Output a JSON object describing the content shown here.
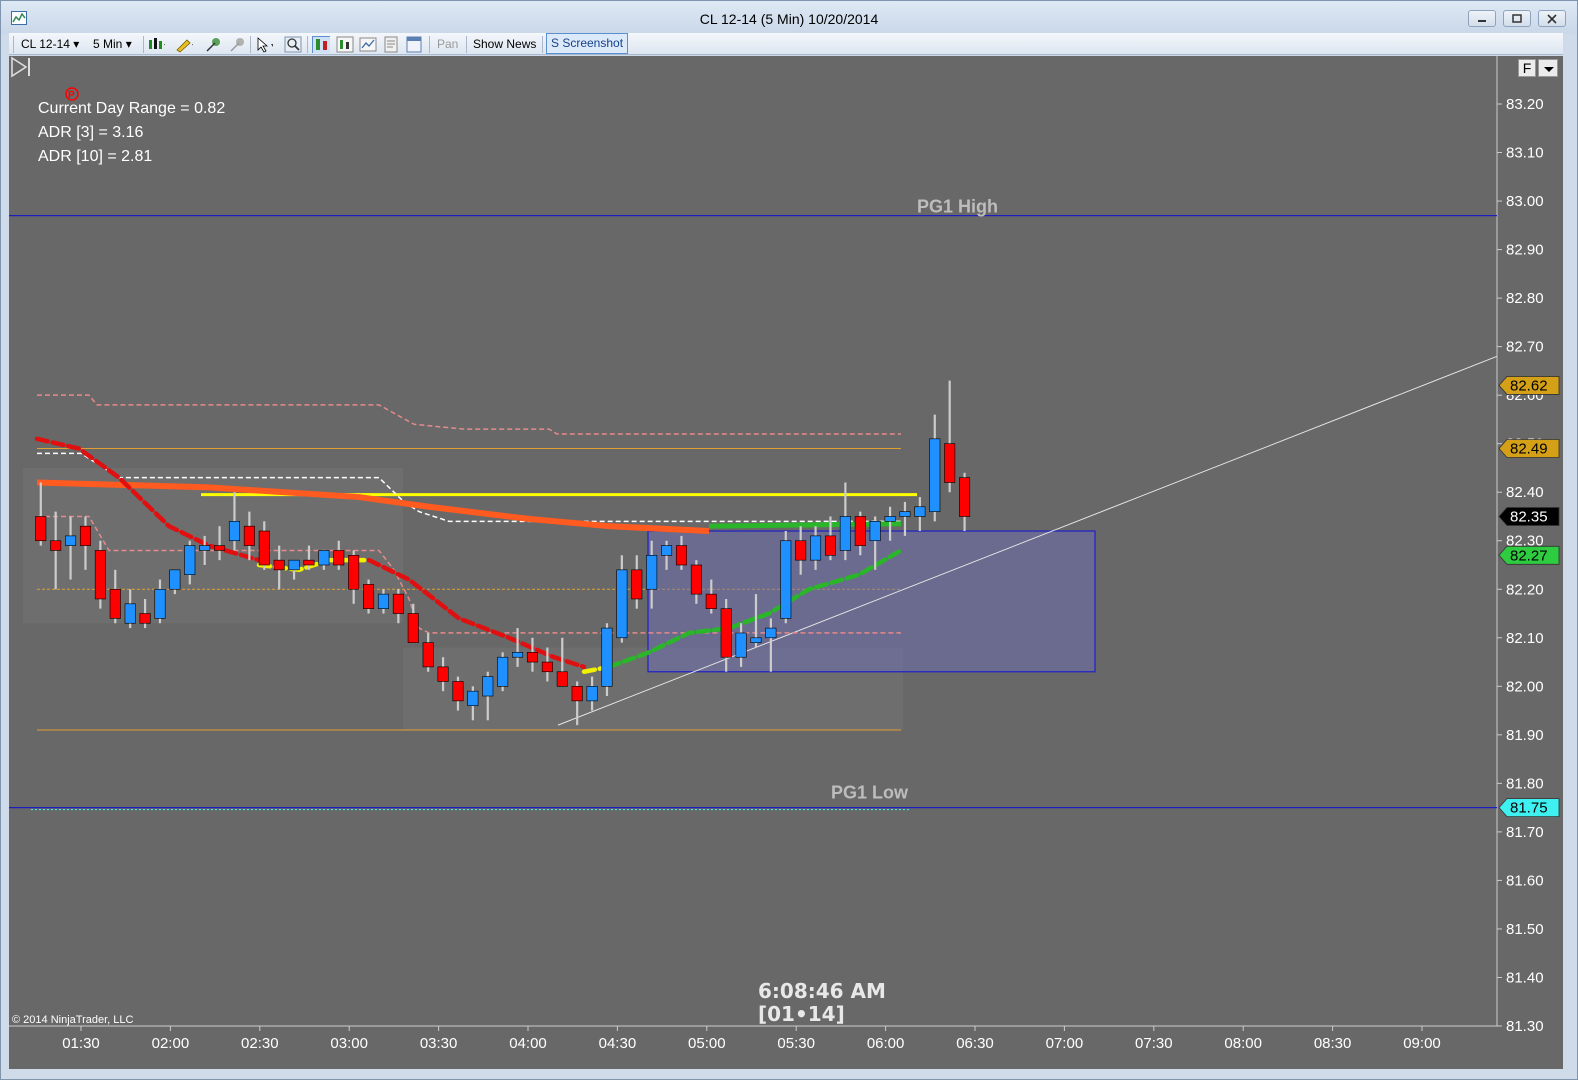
{
  "window": {
    "title": "CL 12-14 (5 Min)  10/20/2014"
  },
  "toolbar": {
    "instrument": "CL 12-14",
    "interval": "5 Min",
    "pan_label": "Pan",
    "news_label": "Show News",
    "screenshot_label": "S Screenshot"
  },
  "info": {
    "range": "Current Day Range = 0.82",
    "adr3": "ADR [3] = 3.16",
    "adr10": "ADR [10] = 2.81"
  },
  "labels": {
    "pg1_high": "PG1 High",
    "pg1_low": "PG1 Low",
    "copyright": "© 2014 NinjaTrader, LLC",
    "clock": "6:08:46 AM",
    "counter": "[01•14]",
    "f_button": "F"
  },
  "chart_data": {
    "type": "candlestick",
    "x_ticks": [
      "01:30",
      "02:00",
      "02:30",
      "03:00",
      "03:30",
      "04:00",
      "04:30",
      "05:00",
      "05:30",
      "06:00",
      "06:30",
      "07:00",
      "07:30",
      "08:00",
      "08:30",
      "09:00"
    ],
    "y_ticks": [
      "83.20",
      "83.10",
      "83.00",
      "82.90",
      "82.80",
      "82.70",
      "82.60",
      "82.50",
      "82.40",
      "82.30",
      "82.20",
      "82.10",
      "82.00",
      "81.90",
      "81.80",
      "81.70",
      "81.60",
      "81.50",
      "81.40",
      "81.30"
    ],
    "ylim": [
      81.3,
      83.2
    ],
    "price_markers": [
      {
        "label": "82.62",
        "value": 82.62,
        "color": "#d4a017"
      },
      {
        "label": "82.49",
        "value": 82.49,
        "color": "#d4a017"
      },
      {
        "label": "82.35",
        "value": 82.35,
        "color": "#000000"
      },
      {
        "label": "82.27",
        "value": 82.27,
        "color": "#2ecc40"
      },
      {
        "label": "81.75",
        "value": 81.75,
        "color": "#3ff0f0"
      }
    ],
    "levels": [
      {
        "name": "PG1 High",
        "value": 82.97,
        "color": "#1e1ebf"
      },
      {
        "name": "PG1 Low",
        "value": 81.75,
        "color": "#1e1ebf"
      },
      {
        "value": 82.49,
        "color": "#e0a030"
      },
      {
        "value": 81.91,
        "color": "#e0a030"
      },
      {
        "value": 82.2,
        "color": "#e0a030"
      },
      {
        "value": 82.395,
        "color": "#ffff00"
      }
    ],
    "colors": {
      "up": "#1e90ff",
      "down": "#ff0000",
      "wick": "#cccccc",
      "background": "#686868"
    },
    "candles": [
      {
        "o": 82.35,
        "h": 82.42,
        "l": 82.29,
        "c": 82.3
      },
      {
        "o": 82.3,
        "h": 82.36,
        "l": 82.2,
        "c": 82.28
      },
      {
        "o": 82.29,
        "h": 82.35,
        "l": 82.22,
        "c": 82.31
      },
      {
        "o": 82.33,
        "h": 82.35,
        "l": 82.24,
        "c": 82.29
      },
      {
        "o": 82.28,
        "h": 82.3,
        "l": 82.16,
        "c": 82.18
      },
      {
        "o": 82.2,
        "h": 82.24,
        "l": 82.13,
        "c": 82.14
      },
      {
        "o": 82.13,
        "h": 82.2,
        "l": 82.12,
        "c": 82.17
      },
      {
        "o": 82.15,
        "h": 82.18,
        "l": 82.12,
        "c": 82.13
      },
      {
        "o": 82.14,
        "h": 82.22,
        "l": 82.13,
        "c": 82.2
      },
      {
        "o": 82.2,
        "h": 82.24,
        "l": 82.19,
        "c": 82.24
      },
      {
        "o": 82.23,
        "h": 82.3,
        "l": 82.21,
        "c": 82.29
      },
      {
        "o": 82.28,
        "h": 82.31,
        "l": 82.25,
        "c": 82.29
      },
      {
        "o": 82.29,
        "h": 82.33,
        "l": 82.26,
        "c": 82.28
      },
      {
        "o": 82.3,
        "h": 82.4,
        "l": 82.28,
        "c": 82.34
      },
      {
        "o": 82.33,
        "h": 82.36,
        "l": 82.26,
        "c": 82.29
      },
      {
        "o": 82.32,
        "h": 82.34,
        "l": 82.24,
        "c": 82.25
      },
      {
        "o": 82.26,
        "h": 82.29,
        "l": 82.2,
        "c": 82.24
      },
      {
        "o": 82.24,
        "h": 82.26,
        "l": 82.22,
        "c": 82.26
      },
      {
        "o": 82.26,
        "h": 82.29,
        "l": 82.24,
        "c": 82.25
      },
      {
        "o": 82.25,
        "h": 82.28,
        "l": 82.24,
        "c": 82.28
      },
      {
        "o": 82.28,
        "h": 82.3,
        "l": 82.24,
        "c": 82.25
      },
      {
        "o": 82.27,
        "h": 82.28,
        "l": 82.17,
        "c": 82.2
      },
      {
        "o": 82.21,
        "h": 82.22,
        "l": 82.15,
        "c": 82.16
      },
      {
        "o": 82.16,
        "h": 82.2,
        "l": 82.15,
        "c": 82.19
      },
      {
        "o": 82.19,
        "h": 82.2,
        "l": 82.13,
        "c": 82.15
      },
      {
        "o": 82.15,
        "h": 82.17,
        "l": 82.1,
        "c": 82.09
      },
      {
        "o": 82.09,
        "h": 82.11,
        "l": 82.03,
        "c": 82.04
      },
      {
        "o": 82.04,
        "h": 82.06,
        "l": 81.99,
        "c": 82.01
      },
      {
        "o": 82.01,
        "h": 82.02,
        "l": 81.95,
        "c": 81.97
      },
      {
        "o": 81.96,
        "h": 82.0,
        "l": 81.93,
        "c": 81.99
      },
      {
        "o": 81.98,
        "h": 82.03,
        "l": 81.93,
        "c": 82.02
      },
      {
        "o": 82.0,
        "h": 82.07,
        "l": 81.99,
        "c": 82.06
      },
      {
        "o": 82.06,
        "h": 82.12,
        "l": 82.04,
        "c": 82.07
      },
      {
        "o": 82.07,
        "h": 82.1,
        "l": 82.03,
        "c": 82.05
      },
      {
        "o": 82.05,
        "h": 82.08,
        "l": 82.01,
        "c": 82.03
      },
      {
        "o": 82.03,
        "h": 82.1,
        "l": 82.0,
        "c": 82.0
      },
      {
        "o": 82.0,
        "h": 82.01,
        "l": 81.92,
        "c": 81.97
      },
      {
        "o": 81.97,
        "h": 82.02,
        "l": 81.95,
        "c": 82.0
      },
      {
        "o": 82.0,
        "h": 82.13,
        "l": 81.98,
        "c": 82.12
      },
      {
        "o": 82.1,
        "h": 82.27,
        "l": 82.09,
        "c": 82.24
      },
      {
        "o": 82.24,
        "h": 82.27,
        "l": 82.16,
        "c": 82.18
      },
      {
        "o": 82.2,
        "h": 82.3,
        "l": 82.16,
        "c": 82.27
      },
      {
        "o": 82.27,
        "h": 82.3,
        "l": 82.24,
        "c": 82.29
      },
      {
        "o": 82.29,
        "h": 82.31,
        "l": 82.24,
        "c": 82.25
      },
      {
        "o": 82.25,
        "h": 82.26,
        "l": 82.17,
        "c": 82.19
      },
      {
        "o": 82.19,
        "h": 82.22,
        "l": 82.15,
        "c": 82.16
      },
      {
        "o": 82.16,
        "h": 82.18,
        "l": 82.03,
        "c": 82.06
      },
      {
        "o": 82.06,
        "h": 82.13,
        "l": 82.04,
        "c": 82.11
      },
      {
        "o": 82.09,
        "h": 82.19,
        "l": 82.08,
        "c": 82.1
      },
      {
        "o": 82.1,
        "h": 82.14,
        "l": 82.03,
        "c": 82.12
      },
      {
        "o": 82.14,
        "h": 82.32,
        "l": 82.13,
        "c": 82.3
      },
      {
        "o": 82.3,
        "h": 82.33,
        "l": 82.23,
        "c": 82.26
      },
      {
        "o": 82.26,
        "h": 82.33,
        "l": 82.24,
        "c": 82.31
      },
      {
        "o": 82.31,
        "h": 82.35,
        "l": 82.26,
        "c": 82.27
      },
      {
        "o": 82.28,
        "h": 82.42,
        "l": 82.26,
        "c": 82.35
      },
      {
        "o": 82.35,
        "h": 82.36,
        "l": 82.27,
        "c": 82.29
      },
      {
        "o": 82.3,
        "h": 82.35,
        "l": 82.24,
        "c": 82.34
      },
      {
        "o": 82.34,
        "h": 82.37,
        "l": 82.3,
        "c": 82.35
      },
      {
        "o": 82.35,
        "h": 82.38,
        "l": 82.31,
        "c": 82.36
      },
      {
        "o": 82.35,
        "h": 82.39,
        "l": 82.32,
        "c": 82.37
      },
      {
        "o": 82.36,
        "h": 82.56,
        "l": 82.34,
        "c": 82.51
      },
      {
        "o": 82.5,
        "h": 82.63,
        "l": 82.4,
        "c": 82.42
      },
      {
        "o": 82.43,
        "h": 82.44,
        "l": 82.32,
        "c": 82.35
      }
    ]
  }
}
